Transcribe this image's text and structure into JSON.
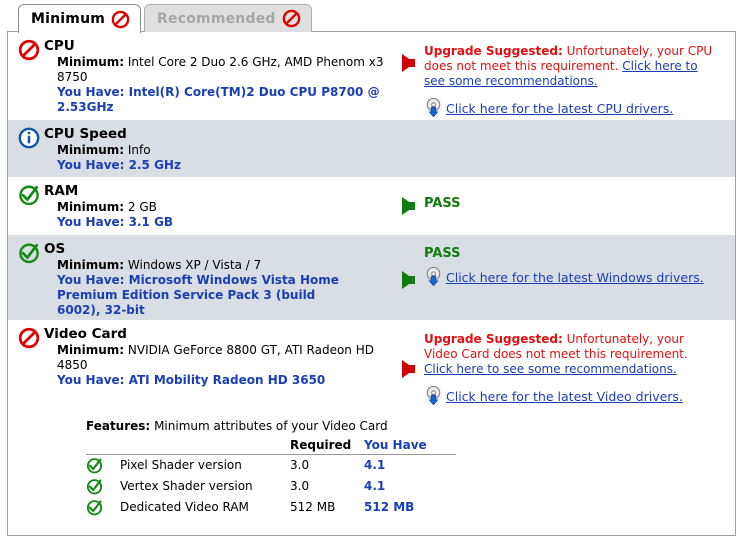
{
  "tabs": [
    {
      "label": "Minimum",
      "state": "active",
      "icon": "no-entry-icon"
    },
    {
      "label": "Recommended",
      "state": "inactive",
      "icon": "no-entry-icon"
    }
  ],
  "requirements": [
    {
      "name": "CPU",
      "icon": "no-entry-icon",
      "minimum_label": "Minimum:",
      "minimum_value": "Intel Core 2 Duo 2.6 GHz, AMD Phenom x3 8750",
      "you_have": "You Have: Intel(R) Core(TM)2 Duo CPU P8700 @ 2.53GHz",
      "arrow_color": "#cc0000",
      "status_kind": "upgrade",
      "upgrade_label": "Upgrade Suggested:",
      "upgrade_text": "Unfortunately, your CPU does not meet this requirement.",
      "upgrade_link": "Click here to see some recommendations.",
      "driver_link": "Click here for the latest CPU drivers.",
      "driver_icon": "disc-download-icon",
      "shaded": false
    },
    {
      "name": "CPU Speed",
      "icon": "info-icon",
      "minimum_label": "Minimum:",
      "minimum_value": "Info",
      "you_have": "You Have: 2.5 GHz",
      "status_kind": "none",
      "shaded": true
    },
    {
      "name": "RAM",
      "icon": "check-circle-icon",
      "minimum_label": "Minimum:",
      "minimum_value": "2 GB",
      "you_have": "You Have: 3.1 GB",
      "arrow_color": "#127c12",
      "status_kind": "pass",
      "pass_label": "PASS",
      "shaded": false
    },
    {
      "name": "OS",
      "icon": "check-circle-icon",
      "minimum_label": "Minimum:",
      "minimum_value": "Windows XP / Vista / 7",
      "you_have": "You Have: Microsoft Windows Vista Home Premium Edition Service Pack 3 (build 6002), 32-bit",
      "arrow_color": "#127c12",
      "status_kind": "pass-with-driver",
      "pass_label": "PASS",
      "driver_link": "Click here for the latest Windows drivers.",
      "driver_icon": "disc-download-icon",
      "shaded": true
    },
    {
      "name": "Video Card",
      "icon": "no-entry-icon",
      "minimum_label": "Minimum:",
      "minimum_value": "NVIDIA GeForce 8800 GT, ATI Radeon HD 4850",
      "you_have": "You Have: ATI Mobility Radeon HD 3650",
      "arrow_color": "#cc0000",
      "status_kind": "upgrade",
      "upgrade_label": "Upgrade Suggested:",
      "upgrade_text": "Unfortunately, your Video Card does not meet this requirement.",
      "upgrade_link": "Click here to see some recommendations.",
      "driver_link": "Click here for the latest Video drivers.",
      "driver_icon": "disc-download-icon",
      "shaded": false
    }
  ],
  "features": {
    "label": "Features:",
    "caption": "Minimum attributes of your Video Card",
    "columns": [
      "",
      "",
      "Required",
      "You Have"
    ],
    "rows": [
      {
        "icon": "check-circle-icon",
        "name": "Pixel Shader version",
        "required": "3.0",
        "you_have": "4.1"
      },
      {
        "icon": "check-circle-icon",
        "name": "Vertex Shader version",
        "required": "3.0",
        "you_have": "4.1"
      },
      {
        "icon": "check-circle-icon",
        "name": "Dedicated Video RAM",
        "required": "512 MB",
        "you_have": "512 MB"
      }
    ]
  },
  "colors": {
    "fail_red": "#cc0000",
    "pass_green": "#127c12",
    "link_blue": "#1a3fb5",
    "alert_red": "#e31010",
    "row_shade": "#d9dde4"
  }
}
